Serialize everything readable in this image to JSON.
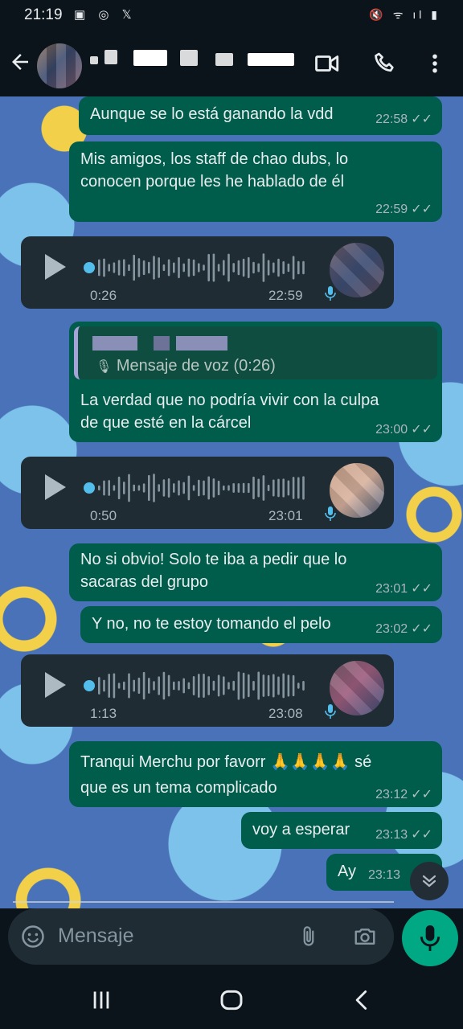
{
  "status_bar": {
    "time": "21:19",
    "left_icons": "▣ ◎ 𝕏",
    "right_icons": "🔇 ᯤ ıl ▮"
  },
  "header": {
    "contact_name_redacted": true
  },
  "composer": {
    "placeholder": "Mensaje"
  },
  "messages": [
    {
      "type": "text",
      "dir": "out",
      "text": "Aunque se lo está ganando la vdd",
      "time": "22:58",
      "status": "read"
    },
    {
      "type": "text",
      "dir": "out",
      "text": "Mis amigos, los staff de chao dubs, lo\nconocen porque les he hablado de él",
      "time": "22:59",
      "status": "read"
    },
    {
      "type": "voice",
      "dir": "in",
      "duration": "0:26",
      "time": "22:59"
    },
    {
      "type": "reply",
      "dir": "out",
      "quote_text": "Mensaje de voz (0:26)",
      "text": "La verdad que no podría vivir con la culpa\nde que esté en la cárcel",
      "time": "23:00",
      "status": "read"
    },
    {
      "type": "voice",
      "dir": "in",
      "duration": "0:50",
      "time": "23:01"
    },
    {
      "type": "text",
      "dir": "out",
      "text": "No si obvio! Solo te iba a pedir que lo\nsacaras del grupo",
      "time": "23:01",
      "status": "read"
    },
    {
      "type": "text",
      "dir": "out",
      "text": "Y no, no te estoy tomando el pelo",
      "time": "23:02",
      "status": "read"
    },
    {
      "type": "voice",
      "dir": "in",
      "duration": "1:13",
      "time": "23:08"
    },
    {
      "type": "text",
      "dir": "out",
      "text": "Tranqui Merchu por favorr 🙏🙏🙏🙏 sé\nque es un tema complicado",
      "time": "23:12",
      "status": "read"
    },
    {
      "type": "text",
      "dir": "out",
      "text": "voy a esperar",
      "time": "23:13",
      "status": "read"
    },
    {
      "type": "text",
      "dir": "out",
      "text": "Ay",
      "time": "23:13",
      "status": "read"
    }
  ],
  "icons": {
    "back": "arrow-left-icon",
    "video": "video-call-icon",
    "call": "phone-icon",
    "menu": "more-vert-icon",
    "emoji": "emoji-icon",
    "attach": "paperclip-icon",
    "camera": "camera-icon",
    "mic": "mic-icon"
  },
  "colors": {
    "outgoing": "#005c4b",
    "incoming": "#202c33",
    "accent": "#00a884",
    "read_ticks": "#53bdeb"
  }
}
